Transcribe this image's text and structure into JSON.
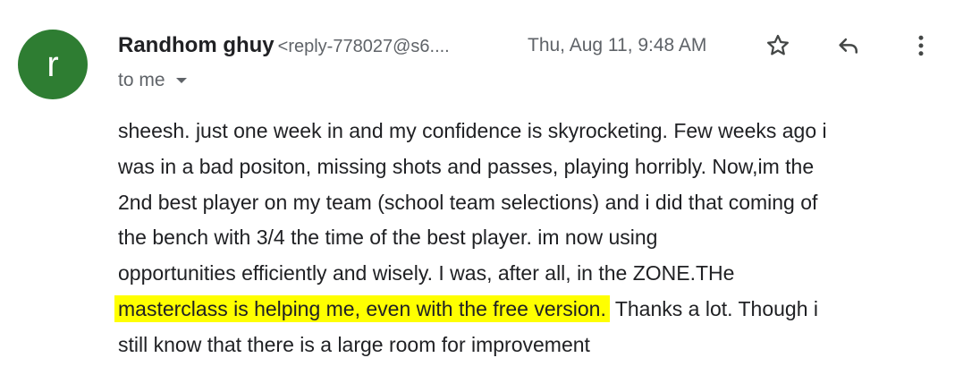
{
  "sender": {
    "avatar_letter": "r",
    "avatar_color": "#2e7d32",
    "name": "Randhom ghuy",
    "email": "<reply-778027@s6....",
    "date": "Thu, Aug 11, 9:48 AM",
    "recipient": "to me"
  },
  "icons": {
    "star": "star-icon",
    "reply": "reply-icon",
    "more": "more-vert-icon",
    "dropdown": "chevron-down-icon"
  },
  "message": {
    "line1": "sheesh. just one week in and my confidence is skyrocketing. Few weeks ago i",
    "line2": "was in a bad positon, missing shots and passes, playing horribly. Now,im the",
    "line3": "2nd best player on my team (school team selections) and i did that coming of",
    "line4": "the bench with 3/4 the time of the best player. im now using",
    "line5": "opportunities efficiently and wisely. I was, after all, in the ZONE.THe",
    "line6_highlight": "masterclass is helping me, even with the free version.",
    "line6_rest": " Thanks a lot. Though i",
    "line7": "still know that there is a large room for improvement",
    "highlight_color": "#ffff00"
  }
}
